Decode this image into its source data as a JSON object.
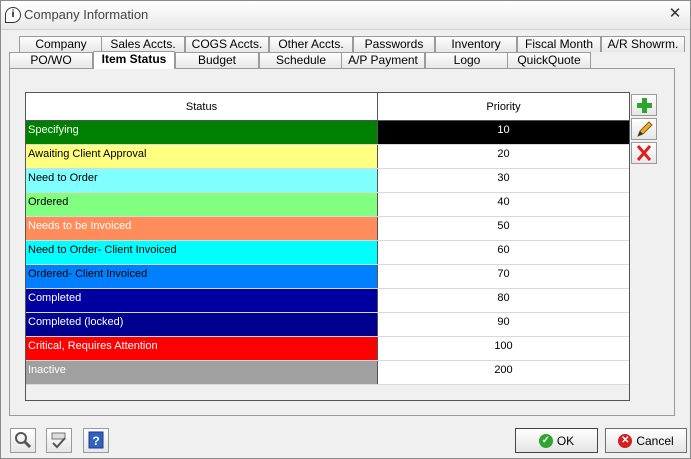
{
  "window": {
    "title": "Company Information"
  },
  "tabs_back": [
    {
      "label": "Company"
    },
    {
      "label": "Sales Accts."
    },
    {
      "label": "COGS Accts."
    },
    {
      "label": "Other Accts."
    },
    {
      "label": "Passwords"
    },
    {
      "label": "Inventory"
    },
    {
      "label": "Fiscal Month"
    },
    {
      "label": "A/R Showrm."
    }
  ],
  "tabs_front": [
    {
      "label": "PO/WO"
    },
    {
      "label": "Item Status"
    },
    {
      "label": "Budget"
    },
    {
      "label": "Schedule"
    },
    {
      "label": "A/P Payment"
    },
    {
      "label": "Logo"
    },
    {
      "label": "QuickQuote"
    }
  ],
  "active_tab": "Item Status",
  "grid": {
    "headers": {
      "status": "Status",
      "priority": "Priority"
    },
    "rows": [
      {
        "status": "Specifying",
        "priority": "10",
        "bg": "#008000",
        "fg": "#ffffff",
        "pbg": "#000000",
        "pfg": "#ffffff"
      },
      {
        "status": "Awaiting Client Approval",
        "priority": "20",
        "bg": "#ffff80",
        "fg": "#000000"
      },
      {
        "status": "Need to Order",
        "priority": "30",
        "bg": "#80ffff",
        "fg": "#000000"
      },
      {
        "status": "Ordered",
        "priority": "40",
        "bg": "#80ff80",
        "fg": "#000000"
      },
      {
        "status": "Needs to be Invoiced",
        "priority": "50",
        "bg": "#ff8c5a",
        "fg": "#ffffff"
      },
      {
        "status": "Need to Order- Client Invoiced",
        "priority": "60",
        "bg": "#00ffff",
        "fg": "#000000"
      },
      {
        "status": "Ordered- Client Invoiced",
        "priority": "70",
        "bg": "#0080ff",
        "fg": "#000000"
      },
      {
        "status": "Completed",
        "priority": "80",
        "bg": "#0000a0",
        "fg": "#ffffff"
      },
      {
        "status": "Completed (locked)",
        "priority": "90",
        "bg": "#000090",
        "fg": "#ffffff"
      },
      {
        "status": "Critical, Requires Attention",
        "priority": "100",
        "bg": "#ff0000",
        "fg": "#ffffff"
      },
      {
        "status": "Inactive",
        "priority": "200",
        "bg": "#a0a0a0",
        "fg": "#ffffff"
      }
    ]
  },
  "side_buttons": [
    {
      "icon": "plus-icon",
      "color": "#2ea52e"
    },
    {
      "icon": "pencil-icon",
      "color": "#e0a020"
    },
    {
      "icon": "delete-x-icon",
      "color": "#e02020"
    }
  ],
  "footer": {
    "ok_label": "OK",
    "cancel_label": "Cancel",
    "tools": [
      {
        "icon": "magnifier-icon"
      },
      {
        "icon": "spellcheck-icon"
      },
      {
        "icon": "help-icon"
      }
    ]
  }
}
